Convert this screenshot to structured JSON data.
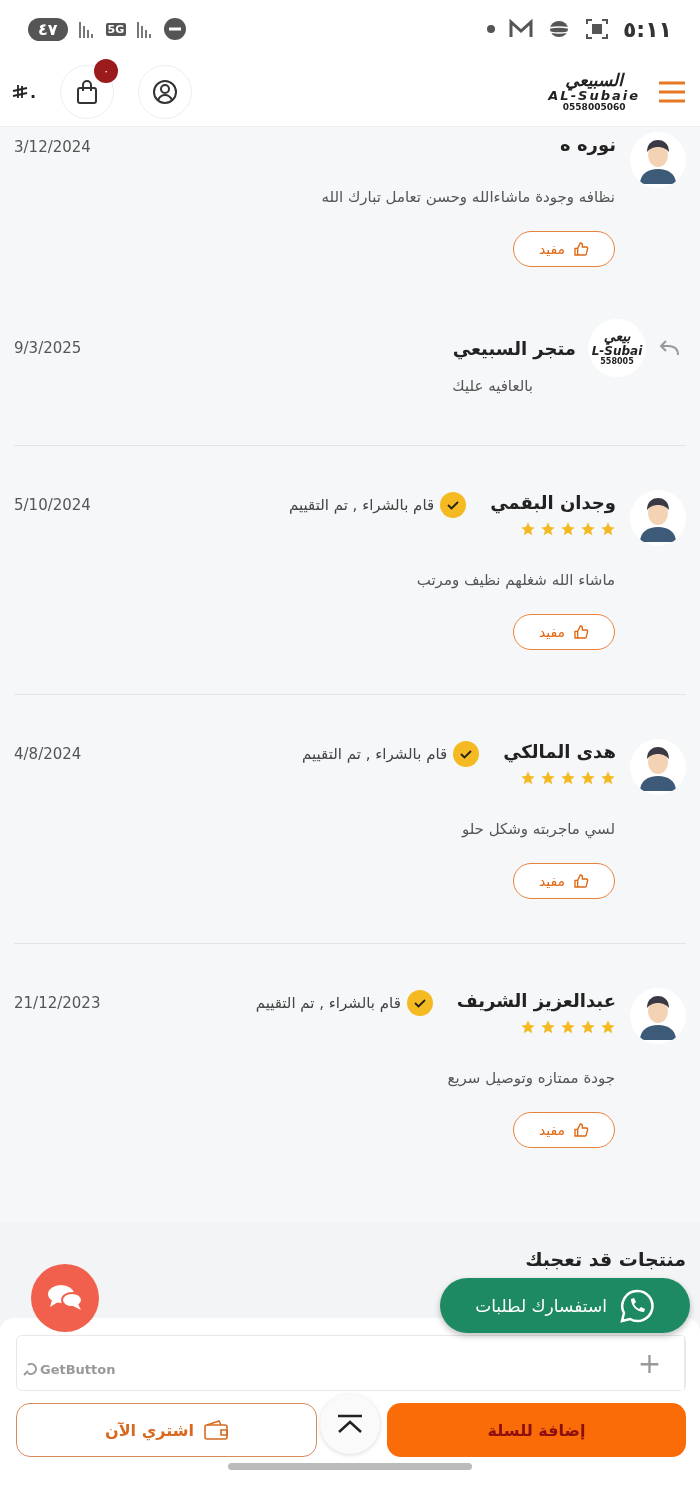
{
  "status_bar": {
    "time": "٥:١١",
    "battery": "٤٧",
    "network": "5G"
  },
  "header": {
    "logo": {
      "arabic": "السبيعي",
      "latin": "AL-Subaie",
      "phone": "0558005060"
    },
    "cart_count": "٠",
    "price": "."
  },
  "reviews": [
    {
      "kind": "review",
      "name": "نوره ه",
      "date": "3/12/2024",
      "text": "نظافه وجودة ماشاءالله وحسن تعامل تبارك الله",
      "helpful": "مفيد"
    },
    {
      "kind": "reply",
      "name": "متجر السبيعي",
      "date": "9/3/2025",
      "text": "بالعافيه عليك",
      "logo": {
        "arabic": "بيعي",
        "latin": "L-Subai",
        "phone": "558005"
      }
    },
    {
      "kind": "review",
      "name": "وجدان البقمي",
      "verified": "قام بالشراء , تم التقييم",
      "stars": 5,
      "date": "5/10/2024",
      "text": "ماشاء الله شغلهم نظيف ومرتب",
      "helpful": "مفيد"
    },
    {
      "kind": "review",
      "name": "هدى المالكي",
      "verified": "قام بالشراء , تم التقييم",
      "stars": 5,
      "date": "4/8/2024",
      "text": "لسي ماجربته وشكل حلو",
      "helpful": "مفيد"
    },
    {
      "kind": "review",
      "name": "عبدالعزيز الشريف",
      "verified": "قام بالشراء , تم التقييم",
      "stars": 5,
      "date": "21/12/2023",
      "text": "جودة ممتازه وتوصيل سريع",
      "helpful": "مفيد"
    }
  ],
  "related": {
    "title": "منتجات قد تعجبك"
  },
  "bottom_bar": {
    "plus": "+",
    "add_to_cart": "إضافة للسلة",
    "buy_now": "اشتري الآن"
  },
  "whatsapp": {
    "label": "استفسارك لطلبات"
  },
  "chat_widget": {
    "label": "GetButton"
  }
}
